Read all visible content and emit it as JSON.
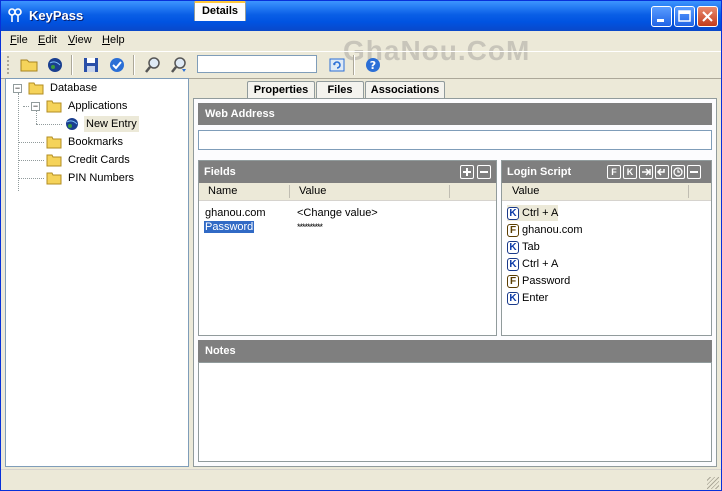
{
  "window": {
    "title": "KeyPass"
  },
  "watermark": "GhaNou.CoM",
  "menu": [
    {
      "label": "File",
      "key": "F",
      "rest": "ile"
    },
    {
      "label": "Edit",
      "key": "E",
      "rest": "dit"
    },
    {
      "label": "View",
      "key": "V",
      "rest": "iew"
    },
    {
      "label": "Help",
      "key": "H",
      "rest": "elp"
    }
  ],
  "toolbar": {
    "search_value": ""
  },
  "tree": {
    "root": "Database",
    "applications": "Applications",
    "new_entry": "New Entry",
    "bookmarks": "Bookmarks",
    "credit_cards": "Credit Cards",
    "pin_numbers": "PIN Numbers"
  },
  "tabs": [
    "Details",
    "Properties",
    "Files",
    "Associations"
  ],
  "details": {
    "web_address_label": "Web Address",
    "web_address_value": "",
    "fields_label": "Fields",
    "fields_columns": [
      "Name",
      "Value"
    ],
    "fields_rows": [
      {
        "name": "ghanou.com",
        "value": "<Change value>"
      },
      {
        "name": "Password",
        "value": "**********"
      }
    ],
    "login_script_label": "Login Script",
    "login_script_column": "Value",
    "login_script_rows": [
      {
        "type": "K",
        "text": "Ctrl + A"
      },
      {
        "type": "F",
        "text": "ghanou.com"
      },
      {
        "type": "K",
        "text": "Tab"
      },
      {
        "type": "K",
        "text": "Ctrl + A"
      },
      {
        "type": "F",
        "text": "Password"
      },
      {
        "type": "K",
        "text": "Enter"
      }
    ],
    "notes_label": "Notes",
    "notes_value": ""
  },
  "colors": {
    "titlebar": "#0a5fe6",
    "section_header": "#7f7f7f",
    "selection": "#316ac5",
    "tab_highlight": "#ffc83c"
  }
}
